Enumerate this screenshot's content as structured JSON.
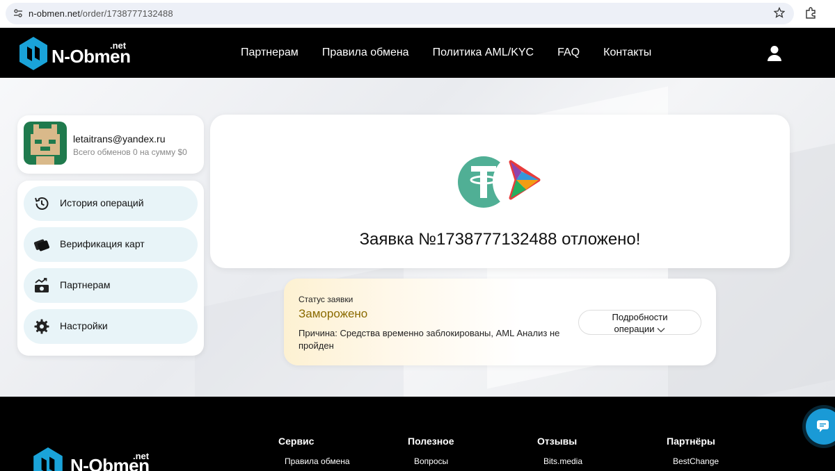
{
  "browser": {
    "url_host": "n-obmen.net",
    "url_path": "/order/1738777132488"
  },
  "header": {
    "logo_name": "N-Obmen",
    "logo_tld": ".net",
    "nav": [
      "Партнерам",
      "Правила обмена",
      "Политика AML/KYC",
      "FAQ",
      "Контакты"
    ]
  },
  "profile": {
    "email": "letaitrans@yandex.ru",
    "stats": "Всего обменов 0 на сумму $0"
  },
  "sidebar": {
    "items": [
      {
        "label": "История операций",
        "icon": "history-icon"
      },
      {
        "label": "Верификация карт",
        "icon": "card-icon"
      },
      {
        "label": "Партнерам",
        "icon": "money-growth-icon"
      },
      {
        "label": "Настройки",
        "icon": "gear-icon"
      }
    ]
  },
  "order": {
    "title": "Заявка №1738777132488 отложено!",
    "status_caption": "Статус заявки",
    "status_value": "Заморожено",
    "reason": "Причина: Средства временно заблокированы, AML Анализ не пройден",
    "details_line1": "Подробности",
    "details_line2": "операции",
    "status_color": "#8a6a00"
  },
  "footer": {
    "logo_name": "N-Obmen",
    "logo_tld": ".net",
    "columns": [
      {
        "heading": "Сервис",
        "link": "Правила обмена"
      },
      {
        "heading": "Полезное",
        "link": "Вопросы"
      },
      {
        "heading": "Отзывы",
        "link": "Bits.media"
      },
      {
        "heading": "Партнёры",
        "link": "BestChange"
      }
    ]
  },
  "colors": {
    "brand_blue": "#1aa3d9",
    "menu_bg": "#e8f4f8",
    "tether_green": "#50af95"
  }
}
